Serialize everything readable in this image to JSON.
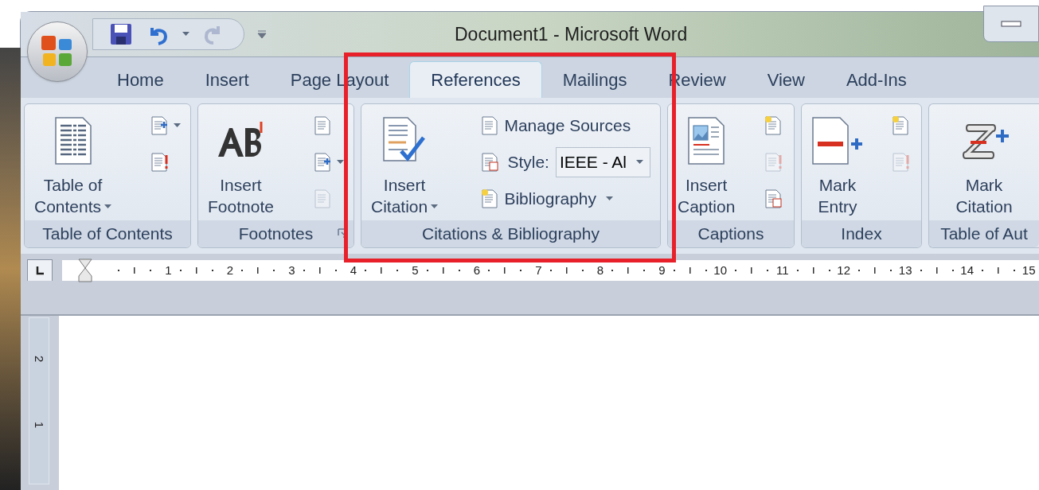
{
  "window": {
    "title": "Document1 - Microsoft Word"
  },
  "tabs": [
    {
      "label": "Home",
      "selected": false
    },
    {
      "label": "Insert",
      "selected": false
    },
    {
      "label": "Page Layout",
      "selected": false
    },
    {
      "label": "References",
      "selected": true
    },
    {
      "label": "Mailings",
      "selected": false
    },
    {
      "label": "Review",
      "selected": false
    },
    {
      "label": "View",
      "selected": false
    },
    {
      "label": "Add-Ins",
      "selected": false
    }
  ],
  "groups": [
    {
      "label": "Table of Contents",
      "launcher": false,
      "large": {
        "lines": [
          "Table of",
          "Contents"
        ],
        "dropdown": true
      },
      "small": [
        {
          "kind": "icon",
          "dropdown": true,
          "disabled": false
        },
        {
          "kind": "icon",
          "dropdown": false,
          "disabled": false
        }
      ]
    },
    {
      "label": "Footnotes",
      "launcher": true,
      "large": {
        "lines": [
          "Insert",
          "Footnote"
        ],
        "dropdown": false
      },
      "small": [
        {
          "kind": "icon",
          "dropdown": false,
          "disabled": false
        },
        {
          "kind": "icon",
          "dropdown": true,
          "disabled": false
        },
        {
          "kind": "icon",
          "dropdown": false,
          "disabled": true
        }
      ]
    },
    {
      "label": "Citations & Bibliography",
      "launcher": false,
      "large": {
        "lines": [
          "Insert",
          "Citation"
        ],
        "dropdown": true
      },
      "small": [
        {
          "kind": "labeled",
          "label": "Manage Sources",
          "dropdown": false,
          "disabled": false
        },
        {
          "kind": "combo",
          "label": "Style:",
          "value": "IEEE - Al",
          "dropdown": true,
          "disabled": false
        },
        {
          "kind": "labeled",
          "label": "Bibliography",
          "dropdown": true,
          "disabled": false
        }
      ]
    },
    {
      "label": "Captions",
      "launcher": false,
      "large": {
        "lines": [
          "Insert",
          "Caption"
        ],
        "dropdown": false
      },
      "small": [
        {
          "kind": "icon",
          "dropdown": false,
          "disabled": false
        },
        {
          "kind": "icon",
          "dropdown": false,
          "disabled": true
        },
        {
          "kind": "icon",
          "dropdown": false,
          "disabled": false
        }
      ]
    },
    {
      "label": "Index",
      "launcher": false,
      "large": {
        "lines": [
          "Mark",
          "Entry"
        ],
        "dropdown": false
      },
      "small": [
        {
          "kind": "icon",
          "dropdown": false,
          "disabled": false
        },
        {
          "kind": "icon",
          "dropdown": false,
          "disabled": true
        }
      ]
    },
    {
      "label": "Table of Aut",
      "launcher": false,
      "large": {
        "lines": [
          "Mark",
          "Citation"
        ],
        "dropdown": false
      }
    }
  ],
  "ruler": {
    "numbers": [
      "1",
      "2",
      "3",
      "4",
      "5",
      "6",
      "7",
      "8",
      "9",
      "10",
      "11",
      "12",
      "13",
      "14",
      "15"
    ]
  },
  "vertical_ruler": {
    "numbers": [
      "2",
      "1"
    ]
  }
}
